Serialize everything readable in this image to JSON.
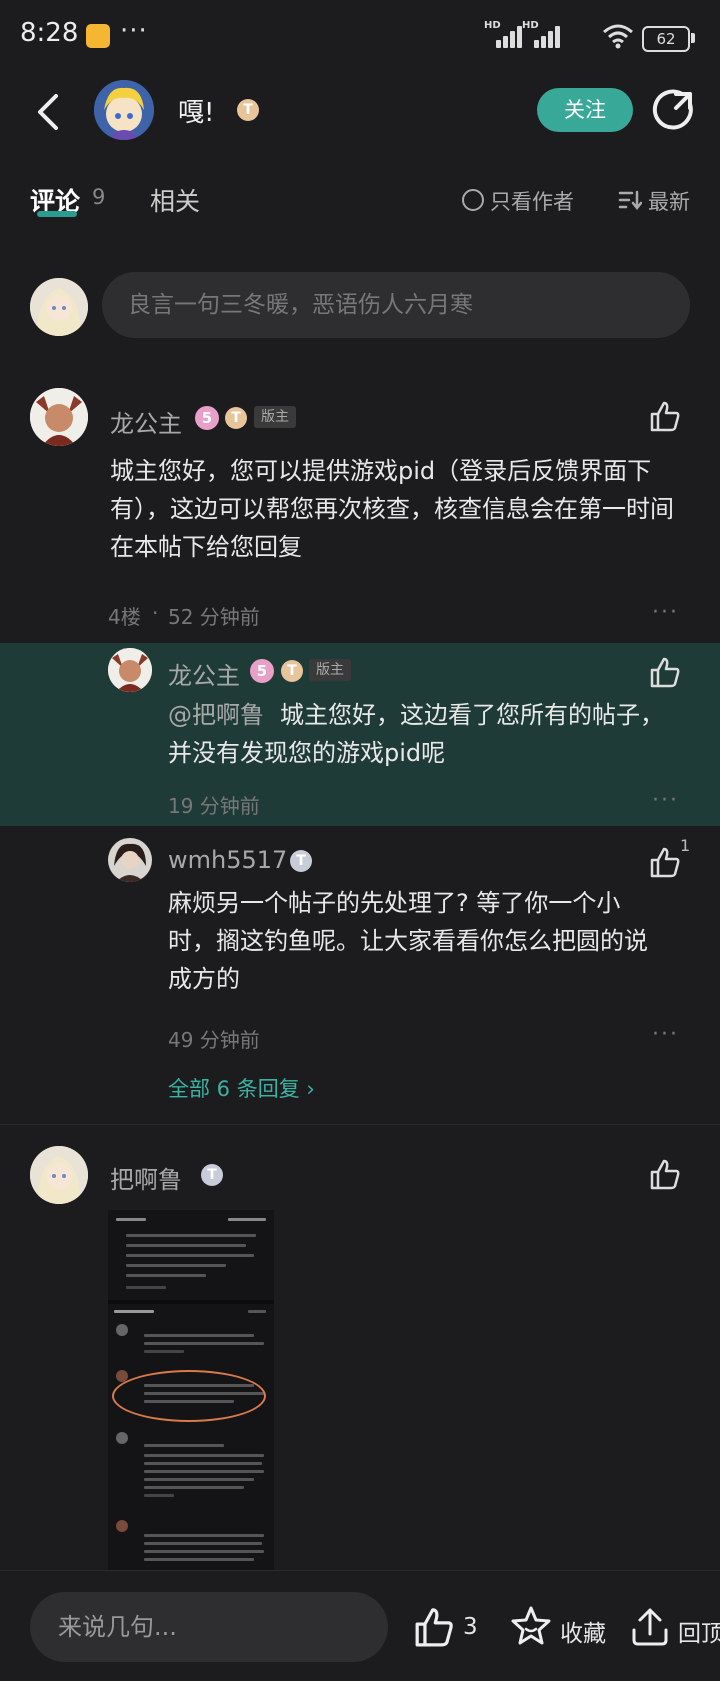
{
  "status": {
    "time": "8:28",
    "dots": "···",
    "sim1": "HD",
    "sim2": "HD",
    "battery": "62"
  },
  "header": {
    "title": "嘎!",
    "level_badge": "T",
    "follow_label": "关注"
  },
  "tabs": {
    "comments_label": "评论",
    "comments_count": "9",
    "related_label": "相关",
    "author_only_label": "只看作者",
    "sort_label": "最新"
  },
  "comment_box": {
    "placeholder": "良言一句三冬暖，恶语伤人六月寒"
  },
  "comments": [
    {
      "user": "龙公主",
      "level": "5",
      "badge": "T",
      "tag": "版主",
      "text": "城主您好，您可以提供游戏pid（登录后反馈界面下有），这边可以帮您再次核查，核查信息会在第一时间在本帖下给您回复",
      "floor": "4楼",
      "time": "52 分钟前",
      "more": "···",
      "replies": [
        {
          "user": "龙公主",
          "level": "5",
          "badge": "T",
          "tag": "版主",
          "mention": "@把啊鲁",
          "text": "城主您好，这边看了您所有的帖子，并没有发现您的游戏pid呢",
          "time": "19 分钟前",
          "more": "···"
        },
        {
          "user": "wmh5517",
          "badge": "T",
          "text": "麻烦另一个帖子的先处理了? 等了你一个小时，搁这钓鱼呢。让大家看看你怎么把圆的说成方的",
          "time": "49 分钟前",
          "like_count": "1",
          "more": "···"
        }
      ],
      "all_replies_label": "全部 6 条回复 ›"
    },
    {
      "user": "把啊鲁",
      "badge": "T"
    }
  ],
  "bottom": {
    "input_placeholder": "来说几句...",
    "like_count": "3",
    "favorite_label": "收藏",
    "top_label": "回顶"
  },
  "colors": {
    "accent": "#38a898",
    "highlight_bg": "#1f3b37",
    "background": "#1c1c1e"
  }
}
